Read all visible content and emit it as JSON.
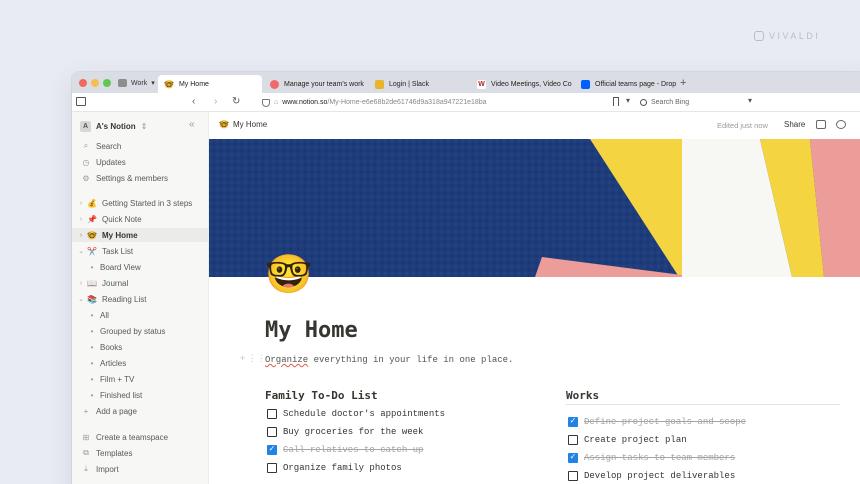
{
  "brand": "VIVALDI",
  "browser": {
    "workspace": "Work",
    "tabs": [
      {
        "label": "My Home",
        "favicon": "🤓",
        "active": true
      },
      {
        "label": "Manage your team's work",
        "favicon": "asana"
      },
      {
        "label": "Login | Slack",
        "favicon": "slack"
      },
      {
        "label": "Video Meetings, Video Co",
        "favicon": "W"
      },
      {
        "label": "Official teams page - Drop",
        "favicon": "dropbox"
      }
    ],
    "url_host": "www.notion.so",
    "url_path": "/My-Home-e6e68b2de61746d9a318a947221e18ba",
    "search_placeholder": "Search Bing"
  },
  "sidebar": {
    "workspace_name": "A's Notion",
    "workspace_initial": "A",
    "top_items": [
      {
        "label": "Search",
        "icon": "search-icon"
      },
      {
        "label": "Updates",
        "icon": "clock-icon"
      },
      {
        "label": "Settings & members",
        "icon": "gear-icon"
      }
    ],
    "pages": [
      {
        "label": "Getting Started in 3 steps",
        "emoji": "💰"
      },
      {
        "label": "Quick Note",
        "emoji": "📌"
      },
      {
        "label": "My Home",
        "emoji": "🤓",
        "active": true
      },
      {
        "label": "Task List",
        "emoji": "✂️"
      },
      {
        "label": "Board View",
        "sub": true
      },
      {
        "label": "Journal",
        "emoji": "📖"
      },
      {
        "label": "Reading List",
        "emoji": "📚"
      },
      {
        "label": "All",
        "sub": true
      },
      {
        "label": "Grouped by status",
        "sub": true
      },
      {
        "label": "Books",
        "sub": true
      },
      {
        "label": "Articles",
        "sub": true
      },
      {
        "label": "Film + TV",
        "sub": true
      },
      {
        "label": "Finished list",
        "sub": true
      }
    ],
    "add_page": "Add a page",
    "bottom_items": [
      {
        "label": "Create a teamspace",
        "icon": "teamspace-icon"
      },
      {
        "label": "Templates",
        "icon": "templates-icon"
      },
      {
        "label": "Import",
        "icon": "import-icon"
      }
    ]
  },
  "header": {
    "breadcrumb": "My Home",
    "edited": "Edited just now",
    "share": "Share"
  },
  "page": {
    "icon": "🤓",
    "title": "My Home",
    "desc_lead": "Organize",
    "desc_rest": " everything in your life in one place."
  },
  "family": {
    "title": "Family To-Do List",
    "items": [
      {
        "text": "Schedule doctor's appointments",
        "done": false
      },
      {
        "text": "Buy groceries for the week",
        "done": false
      },
      {
        "text": "Call relatives to catch up",
        "done": true
      },
      {
        "text": "Organize family photos",
        "done": false
      }
    ]
  },
  "works": {
    "title": "Works",
    "items": [
      {
        "text": "Define project goals and scope",
        "done": true
      },
      {
        "text": "Create project plan",
        "done": false
      },
      {
        "text": "Assign tasks to team members",
        "done": true
      },
      {
        "text": "Develop project deliverables",
        "done": false
      }
    ]
  },
  "colors": {
    "checkbox_checked": "#2383e2",
    "cover_blue": "#1f3c7a",
    "cover_yellow": "#f5d442",
    "cover_pink": "#ec9d9a"
  }
}
